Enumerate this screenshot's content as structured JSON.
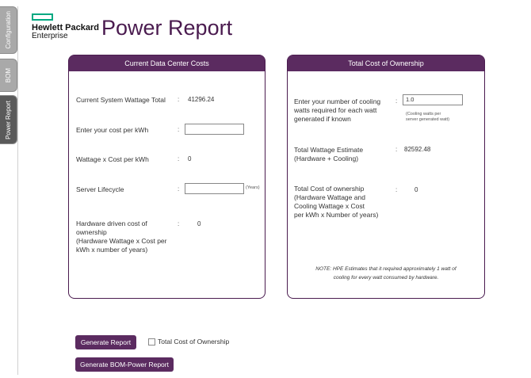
{
  "sidebar": {
    "tabs": [
      {
        "label": "Configuration"
      },
      {
        "label": "BOM"
      },
      {
        "label": "Power Report"
      }
    ]
  },
  "header": {
    "logo_line1": "Hewlett Packard",
    "logo_line2": "Enterprise",
    "title": "Power Report"
  },
  "current_costs": {
    "title": "Current Data Center Costs",
    "system_wattage_label": "Current System Wattage Total",
    "system_wattage_value": "41296.24",
    "cost_per_kwh_label": "Enter your cost  per kWh",
    "cost_per_kwh_value": "",
    "wattage_cost_label": "Wattage x Cost per kWh",
    "wattage_cost_value": "0",
    "lifecycle_label": "Server Lifecycle",
    "lifecycle_value": "",
    "lifecycle_unit": "(Years)",
    "hw_cost_label_1": "Hardware driven cost of",
    "hw_cost_label_2": "ownership",
    "hw_cost_label_3": "(Hardware Wattage x Cost per",
    "hw_cost_label_4": "kWh x number of years)",
    "hw_cost_value": "0"
  },
  "tco": {
    "title": "Total Cost of Ownership",
    "cooling_label_1": "Enter your number of cooling",
    "cooling_label_2": "watts required for each watt",
    "cooling_label_3": "generated if known",
    "cooling_value": "1.0",
    "cooling_hint_1": "(Cooling watts per",
    "cooling_hint_2": "server generated watt)",
    "total_wattage_label_1": "Total Wattage Estimate",
    "total_wattage_label_2": "(Hardware + Cooling)",
    "total_wattage_value": "82592.48",
    "tco_label_1": "Total Cost of ownership",
    "tco_label_2": "(Hardware Wattage and",
    "tco_label_3": "Cooling Wattage x Cost",
    "tco_label_4": "per kWh x Number of years)",
    "tco_value": "0",
    "note_1": "NOTE: HPE Estimates that it required approximately  1 watt of",
    "note_2": "cooling for every watt consumed by hardware."
  },
  "actions": {
    "generate_report": "Generate Report",
    "tco_checkbox_label": "Total Cost of Ownership",
    "generate_bom_power": "Generate BOM-Power Report"
  },
  "colors": {
    "brand_purple": "#5b2b60",
    "hpe_green": "#01a982"
  }
}
